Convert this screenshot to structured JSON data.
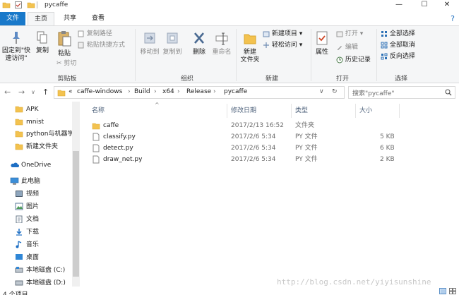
{
  "window": {
    "title": "pycaffe",
    "controls": {
      "minimize": "—",
      "maximize": "☐",
      "close": "✕"
    }
  },
  "ribbon_tabs": [
    "文件",
    "主页",
    "共享",
    "查看"
  ],
  "ribbon": {
    "clipboard": {
      "pin_label": "固定到\"快\n速访问\"",
      "copy": "复制",
      "paste": "粘贴",
      "copy_path": "复制路径",
      "paste_shortcut": "粘贴快捷方式",
      "cut": "剪切",
      "group": "剪贴板"
    },
    "organize": {
      "move_to": "移动到",
      "copy_to": "复制到",
      "delete": "删除",
      "rename": "重命名",
      "group": "组织"
    },
    "new": {
      "new_folder": "新建\n文件夹",
      "new_item": "新建项目 ▾",
      "easy_access": "轻松访问 ▾",
      "group": "新建"
    },
    "open": {
      "properties": "属性",
      "open": "打开 ▾",
      "edit": "编辑",
      "history": "历史记录",
      "group": "打开"
    },
    "select": {
      "select_all": "全部选择",
      "select_none": "全部取消",
      "invert": "反向选择",
      "group": "选择"
    }
  },
  "address": {
    "overflow": "«",
    "crumbs": [
      "caffe-windows",
      "Build",
      "x64",
      "Release",
      "pycaffe"
    ],
    "search_placeholder": "搜索\"pycaffe\""
  },
  "nav": {
    "quick": [
      "APK",
      "mnist",
      "python与机器学",
      "新建文件夹"
    ],
    "onedrive": "OneDrive",
    "this_pc": "此电脑",
    "pc_items": [
      "视频",
      "图片",
      "文档",
      "下载",
      "音乐",
      "桌面",
      "本地磁盘 (C:)",
      "本地磁盘 (D:)"
    ]
  },
  "columns": {
    "name": "名称",
    "modified": "修改日期",
    "type": "类型",
    "size": "大小"
  },
  "files": [
    {
      "name": "caffe",
      "modified": "2017/2/13 16:52",
      "type": "文件夹",
      "size": "",
      "kind": "folder"
    },
    {
      "name": "classify.py",
      "modified": "2017/2/6 5:34",
      "type": "PY 文件",
      "size": "5 KB",
      "kind": "file"
    },
    {
      "name": "detect.py",
      "modified": "2017/2/6 5:34",
      "type": "PY 文件",
      "size": "6 KB",
      "kind": "file"
    },
    {
      "name": "draw_net.py",
      "modified": "2017/2/6 5:34",
      "type": "PY 文件",
      "size": "2 KB",
      "kind": "file"
    }
  ],
  "status": {
    "count": "4 个项目"
  },
  "watermark": "http://blog.csdn.net/yiyisunshine",
  "colors": {
    "accent": "#1979ca",
    "folder": "#f3c24f",
    "header_text": "#4c607a"
  }
}
